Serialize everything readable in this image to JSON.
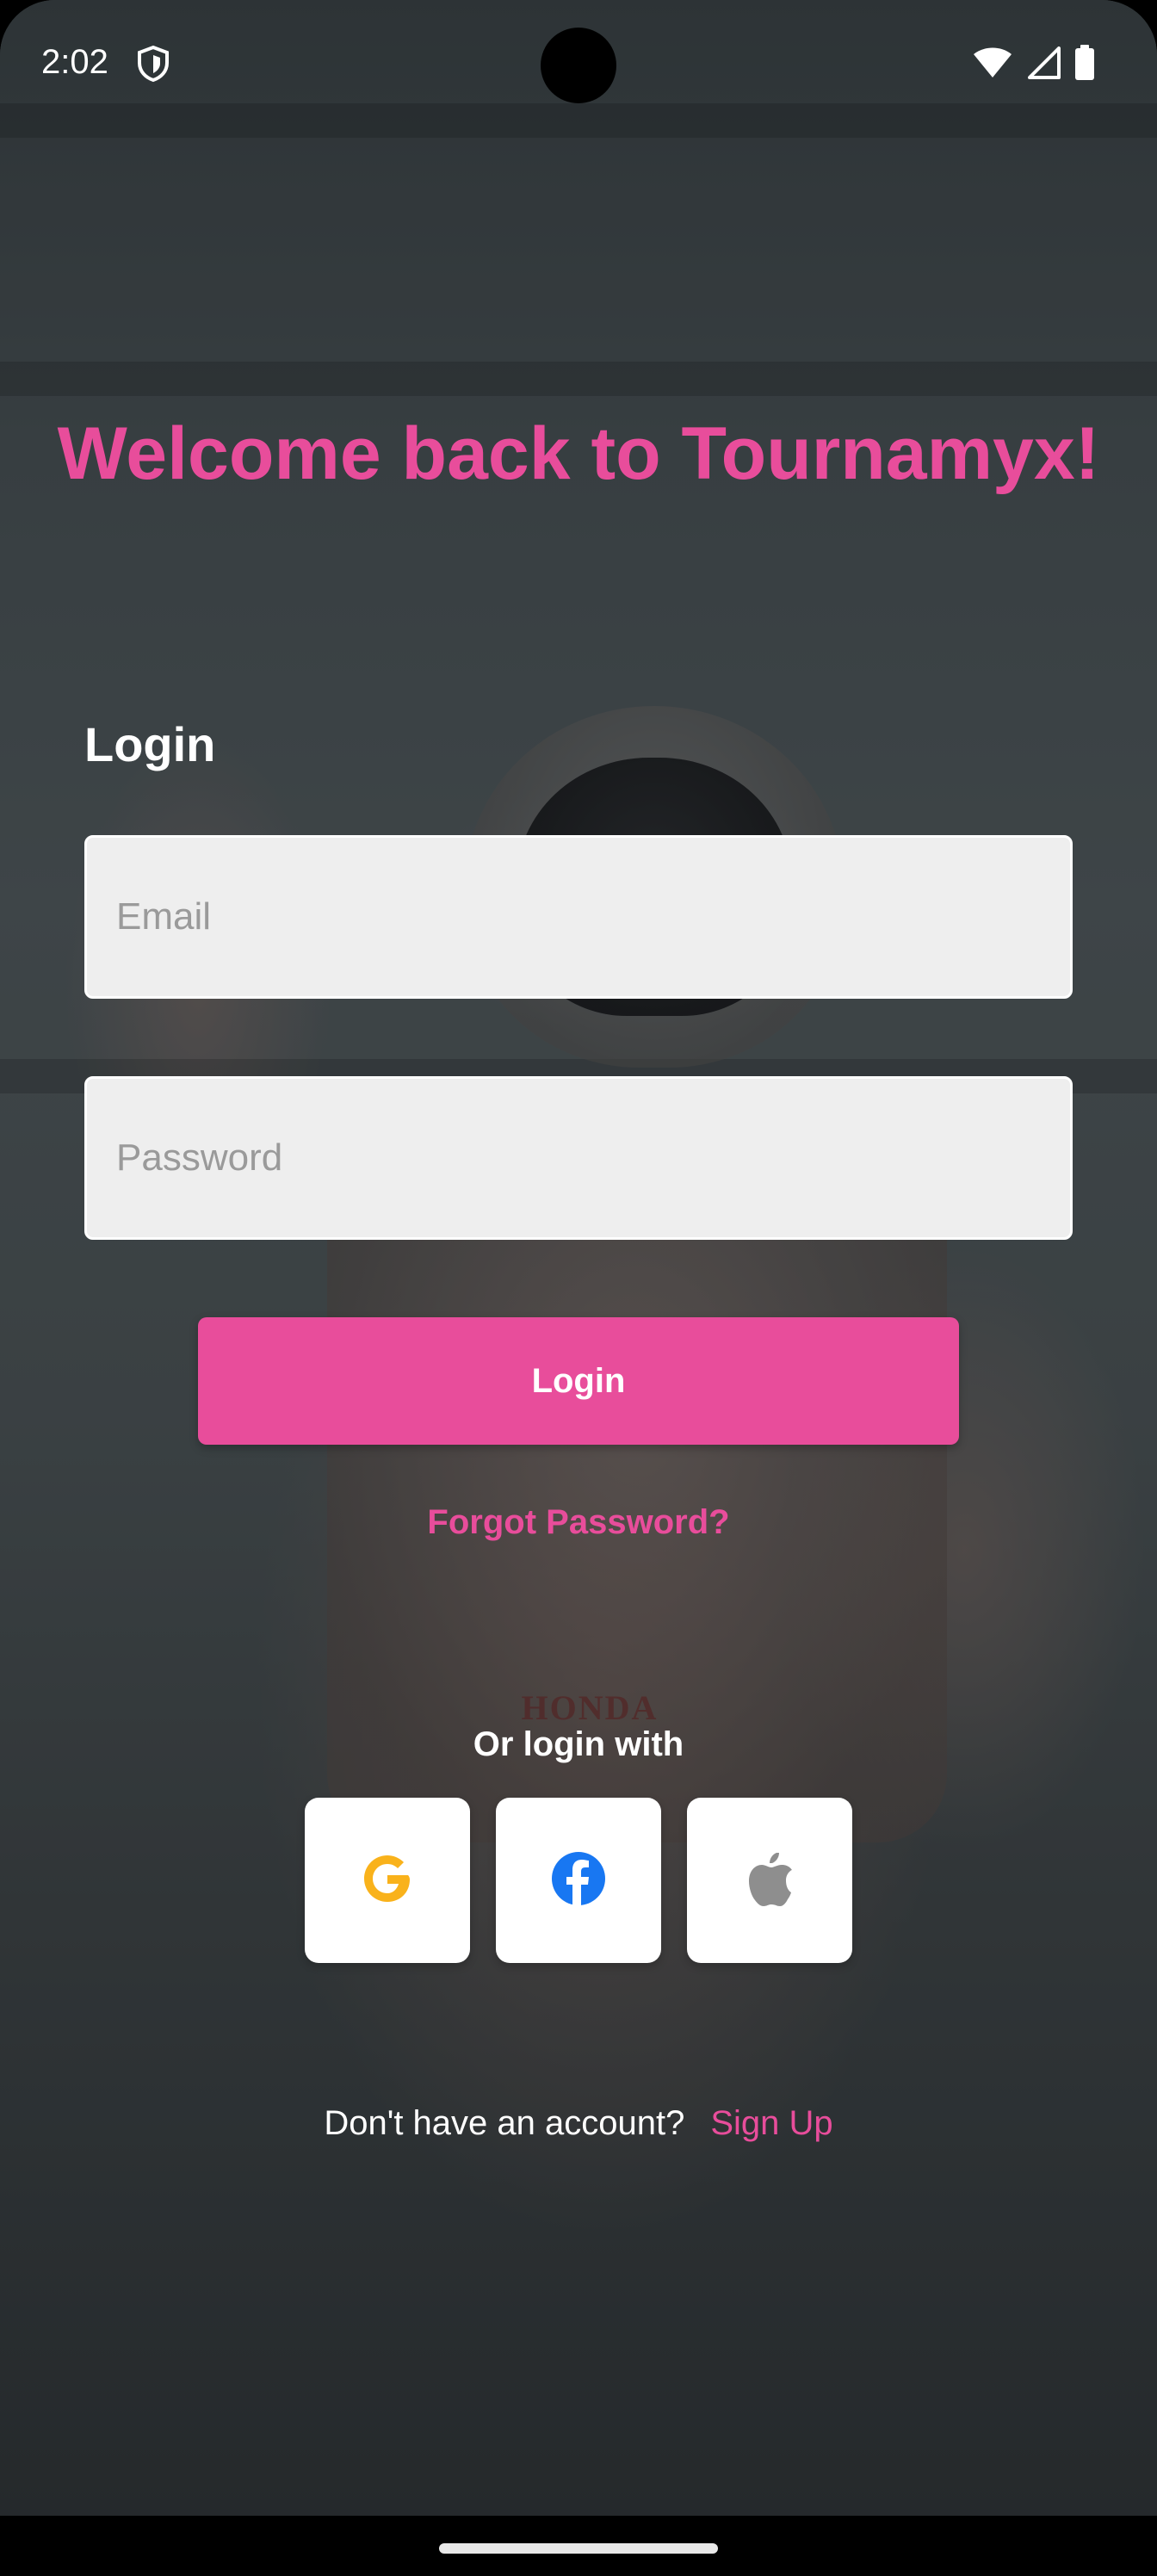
{
  "status_bar": {
    "time": "2:02",
    "icons": [
      "vpn-shield-icon",
      "wifi-icon",
      "cellular-signal-icon",
      "battery-icon"
    ]
  },
  "welcome_title": "Welcome back to Tournamyx!",
  "login_heading": "Login",
  "email": {
    "placeholder": "Email",
    "value": ""
  },
  "password": {
    "placeholder": "Password",
    "value": ""
  },
  "login_button_label": "Login",
  "forgot_password_label": "Forgot Password?",
  "or_login_with_label": "Or login with",
  "social_buttons": [
    "google-icon",
    "facebook-icon",
    "apple-icon"
  ],
  "background_logo_text": "HONDA",
  "signup": {
    "prompt": "Don't have an account?",
    "link_label": "Sign Up"
  },
  "colors": {
    "accent": "#e84d9b",
    "field_background": "#eeeeee",
    "placeholder": "#9a9a9a",
    "google_yellow": "#f9b21b",
    "facebook_blue": "#1877f2",
    "apple_gray": "#8e8e8e"
  }
}
